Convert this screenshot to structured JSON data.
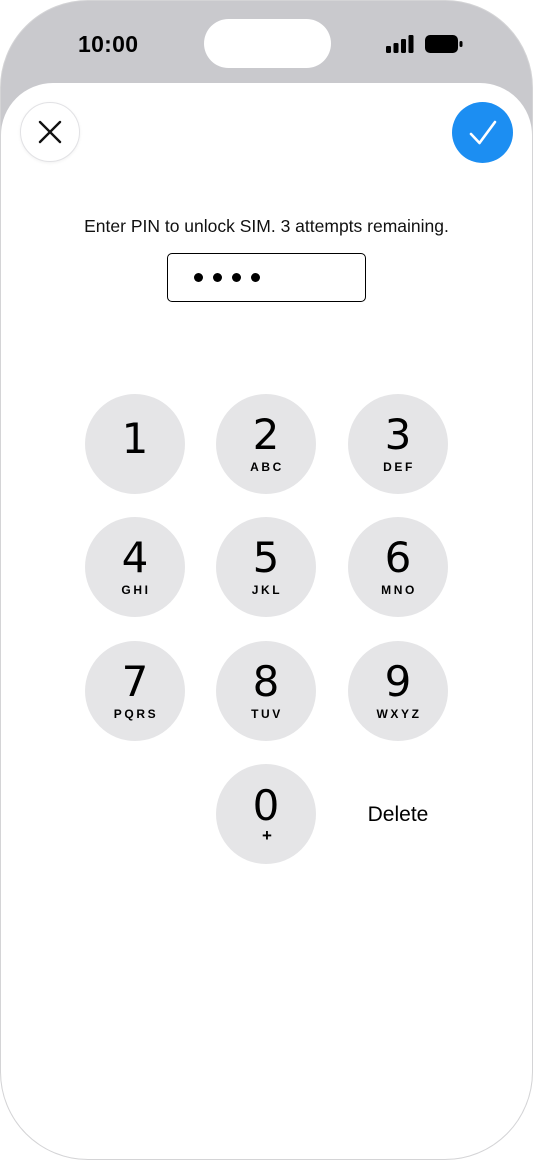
{
  "status_bar": {
    "time": "10:00",
    "signal_icon": "cellular-signal-icon",
    "battery_icon": "battery-full-icon"
  },
  "toolbar": {
    "close_icon": "close-icon",
    "confirm_icon": "checkmark-icon",
    "accent_color": "#1c8ef2"
  },
  "prompt": "Enter PIN to unlock SIM. 3 attempts remaining.",
  "pin": {
    "masked_value": "••••",
    "digits_entered": 4
  },
  "keypad": {
    "keys": [
      {
        "digit": "1",
        "letters": ""
      },
      {
        "digit": "2",
        "letters": "ABC"
      },
      {
        "digit": "3",
        "letters": "DEF"
      },
      {
        "digit": "4",
        "letters": "GHI"
      },
      {
        "digit": "5",
        "letters": "JKL"
      },
      {
        "digit": "6",
        "letters": "MNO"
      },
      {
        "digit": "7",
        "letters": "PQRS"
      },
      {
        "digit": "8",
        "letters": "TUV"
      },
      {
        "digit": "9",
        "letters": "WXYZ"
      },
      {
        "digit": "0",
        "letters": "+"
      }
    ],
    "delete_label": "Delete"
  }
}
